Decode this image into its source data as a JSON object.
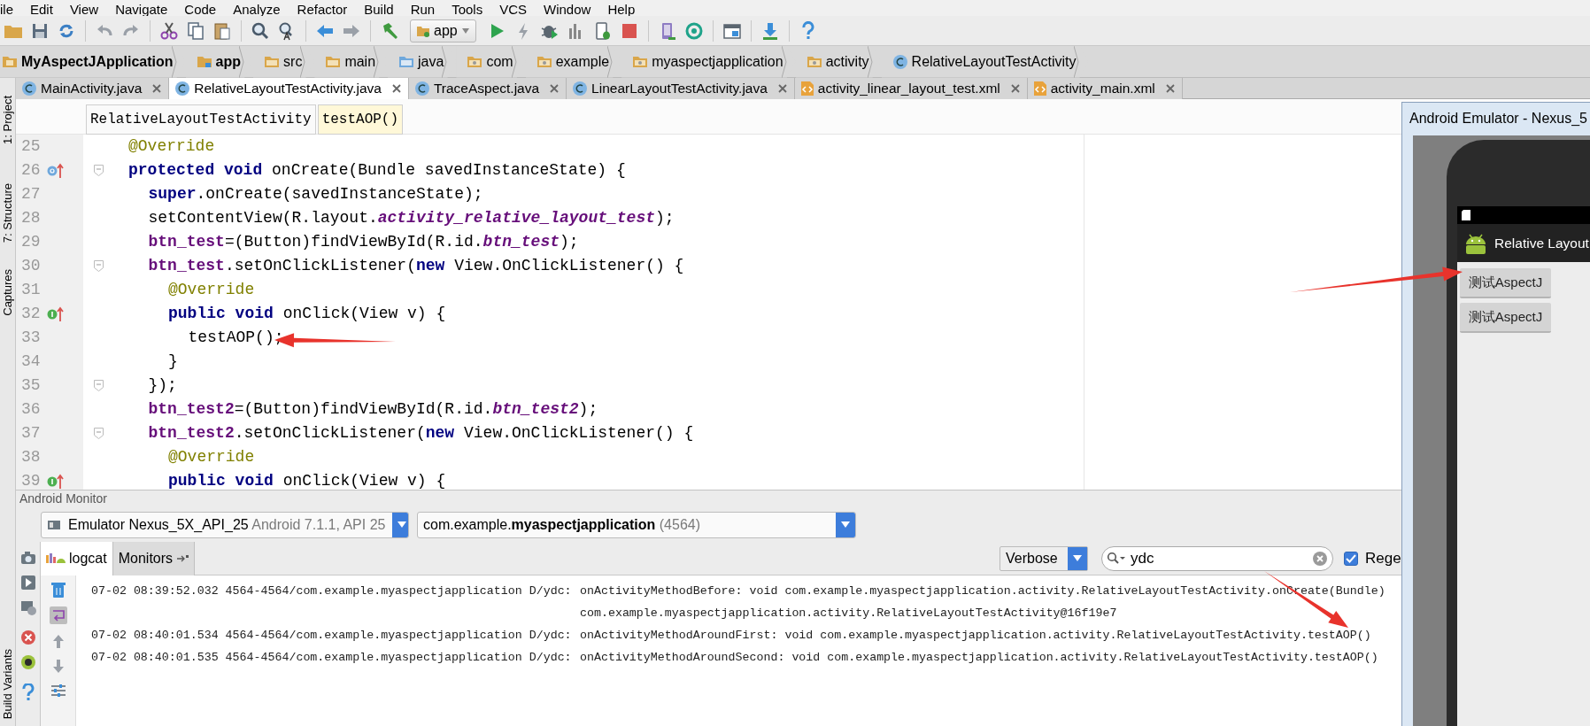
{
  "menu": [
    "ile",
    "Edit",
    "View",
    "Navigate",
    "Code",
    "Analyze",
    "Refactor",
    "Build",
    "Run",
    "Tools",
    "VCS",
    "Window",
    "Help"
  ],
  "toolbar": {
    "run_config": "app"
  },
  "breadcrumb": [
    {
      "label": "MyAspectJApplication",
      "kind": "project"
    },
    {
      "label": "app",
      "kind": "module"
    },
    {
      "label": "src",
      "kind": "folder"
    },
    {
      "label": "main",
      "kind": "folder"
    },
    {
      "label": "java",
      "kind": "source"
    },
    {
      "label": "com",
      "kind": "package"
    },
    {
      "label": "example",
      "kind": "package"
    },
    {
      "label": "myaspectjapplication",
      "kind": "package"
    },
    {
      "label": "activity",
      "kind": "package"
    },
    {
      "label": "RelativeLayoutTestActivity",
      "kind": "class"
    }
  ],
  "tabs": [
    {
      "label": "MainActivity.java",
      "kind": "java",
      "selected": false
    },
    {
      "label": "RelativeLayoutTestActivity.java",
      "kind": "java",
      "selected": true
    },
    {
      "label": "TraceAspect.java",
      "kind": "java",
      "selected": false
    },
    {
      "label": "LinearLayoutTestActivity.java",
      "kind": "java",
      "selected": false
    },
    {
      "label": "activity_linear_layout_test.xml",
      "kind": "xml",
      "selected": false
    },
    {
      "label": "activity_main.xml",
      "kind": "xml",
      "selected": false
    }
  ],
  "side_tools": [
    {
      "label": "1: Project",
      "kind": "top"
    },
    {
      "label": "7: Structure",
      "kind": "top"
    },
    {
      "label": "Captures",
      "kind": "top"
    },
    {
      "label": "Build Variants",
      "kind": "bottom"
    }
  ],
  "method_breadcrumb": [
    {
      "label": "RelativeLayoutTestActivity",
      "selected": false
    },
    {
      "label": "testAOP()",
      "selected": true
    }
  ],
  "code": [
    {
      "n": "25",
      "kind": "plain",
      "fold": false,
      "tokens": [
        {
          "kind": "annotation",
          "text": "@Override"
        }
      ]
    },
    {
      "n": "26",
      "kind": "override",
      "fold": true,
      "tokens": [
        {
          "kind": "keyword",
          "text": "protected void"
        },
        {
          "kind": "plain",
          "text": " onCreate(Bundle savedInstanceState) {"
        }
      ],
      "children": [
        {
          "n": "27",
          "kind": "plain",
          "fold": false,
          "tokens": [
            {
              "kind": "keyword",
              "text": "super"
            },
            {
              "kind": "plain",
              "text": ".onCreate(savedInstanceState);"
            }
          ]
        },
        {
          "n": "28",
          "kind": "plain",
          "fold": false,
          "tokens": [
            {
              "kind": "plain",
              "text": "setContentView(R.layout."
            },
            {
              "kind": "constant",
              "text": "activity_relative_layout_test"
            },
            {
              "kind": "plain",
              "text": ");"
            }
          ]
        },
        {
          "n": "29",
          "kind": "plain",
          "fold": false,
          "tokens": [
            {
              "kind": "field",
              "text": "btn_test"
            },
            {
              "kind": "plain",
              "text": "=(Button)findViewById(R.id."
            },
            {
              "kind": "constant",
              "text": "btn_test"
            },
            {
              "kind": "plain",
              "text": ");"
            }
          ]
        },
        {
          "n": "30",
          "kind": "plain",
          "fold": true,
          "tokens": [
            {
              "kind": "field",
              "text": "btn_test"
            },
            {
              "kind": "plain",
              "text": ".setOnClickListener("
            },
            {
              "kind": "keyword",
              "text": "new"
            },
            {
              "kind": "plain",
              "text": " View.OnClickListener() {"
            }
          ],
          "children": [
            {
              "n": "31",
              "kind": "plain",
              "fold": false,
              "tokens": [
                {
                  "kind": "annotation",
                  "text": "@Override"
                }
              ]
            },
            {
              "n": "32",
              "kind": "implement",
              "fold": false,
              "tokens": [
                {
                  "kind": "keyword",
                  "text": "public void"
                },
                {
                  "kind": "plain",
                  "text": " onClick(View v) {"
                }
              ],
              "children": [
                {
                  "n": "33",
                  "kind": "plain",
                  "fold": false,
                  "tokens": [
                    {
                      "kind": "plain",
                      "text": "testAOP();"
                    }
                  ]
                }
              ]
            },
            {
              "n": "34",
              "kind": "plain",
              "fold": false,
              "tokens": [
                {
                  "kind": "plain",
                  "text": "}"
                }
              ]
            }
          ]
        },
        {
          "n": "35",
          "kind": "plain",
          "fold": true,
          "tokens": [
            {
              "kind": "plain",
              "text": "});"
            }
          ]
        },
        {
          "n": "36",
          "kind": "plain",
          "fold": false,
          "tokens": [
            {
              "kind": "field",
              "text": "btn_test2"
            },
            {
              "kind": "plain",
              "text": "=(Button)findViewById(R.id."
            },
            {
              "kind": "constant",
              "text": "btn_test2"
            },
            {
              "kind": "plain",
              "text": ");"
            }
          ]
        },
        {
          "n": "37",
          "kind": "plain",
          "fold": true,
          "tokens": [
            {
              "kind": "field",
              "text": "btn_test2"
            },
            {
              "kind": "plain",
              "text": ".setOnClickListener("
            },
            {
              "kind": "keyword",
              "text": "new"
            },
            {
              "kind": "plain",
              "text": " View.OnClickListener() {"
            }
          ],
          "children": [
            {
              "n": "38",
              "kind": "plain",
              "fold": false,
              "tokens": [
                {
                  "kind": "annotation",
                  "text": "@Override"
                }
              ]
            },
            {
              "n": "39",
              "kind": "implement",
              "fold": false,
              "tokens": [
                {
                  "kind": "keyword",
                  "text": "public void"
                },
                {
                  "kind": "plain",
                  "text": " onClick(View v) {"
                }
              ]
            }
          ]
        }
      ]
    }
  ],
  "monitor": {
    "title": "Android Monitor",
    "device": {
      "name": "Emulator Nexus_5X_API_25",
      "detail": "Android 7.1.1, API 25"
    },
    "process": {
      "package": "com.example.**myaspectjapplication**",
      "pid": "(4564)"
    },
    "tabs": [
      {
        "label": "logcat",
        "selected": true
      },
      {
        "label": "Monitors",
        "selected": false
      }
    ],
    "level": "Verbose",
    "search": {
      "value": "ydc"
    },
    "regex": {
      "label": "Rege",
      "checked": true
    },
    "logs": [
      {
        "prefix": "07-02 08:39:52.032 4564-4564/com.example.myaspectjapplication D/ydc:",
        "message": "onActivityMethodBefore: void com.example.myaspectjapplication.activity.RelativeLayoutTestActivity.onCreate(Bundle)"
      },
      {
        "message": "com.example.myaspectjapplication.activity.RelativeLayoutTestActivity@16f19e7"
      },
      {
        "prefix": "07-02 08:40:01.534 4564-4564/com.example.myaspectjapplication D/ydc:",
        "message": "onActivityMethodAroundFirst: void com.example.myaspectjapplication.activity.RelativeLayoutTestActivity.testAOP()"
      },
      {
        "prefix": "07-02 08:40:01.535 4564-4564/com.example.myaspectjapplication D/ydc:",
        "message": "onActivityMethodAroundSecond: void com.example.myaspectjapplication.activity.RelativeLayoutTestActivity.testAOP()"
      }
    ]
  },
  "emulator": {
    "title": "Android Emulator - Nexus_5",
    "app_title": "Relative Layout",
    "buttons": [
      "测试AspectJ",
      "测试AspectJ"
    ]
  }
}
